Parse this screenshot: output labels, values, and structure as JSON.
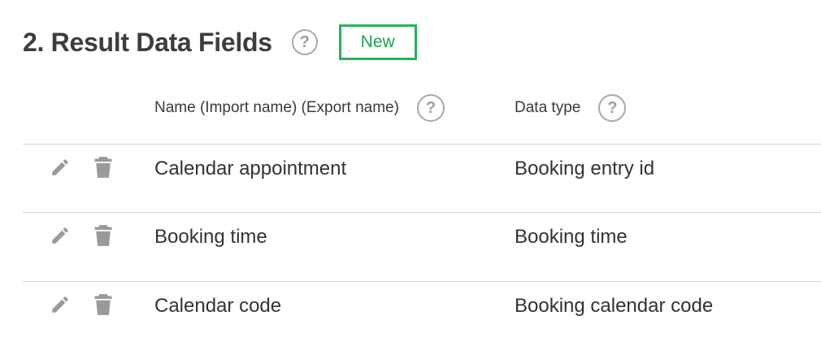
{
  "section": {
    "title": "2. Result Data Fields",
    "help_glyph": "?",
    "new_label": "New",
    "accent_color": "#25b35b"
  },
  "columns": [
    {
      "label": "Name (Import name) (Export name)",
      "help_glyph": "?"
    },
    {
      "label": "Data type",
      "help_glyph": "?"
    }
  ],
  "rows": [
    {
      "name": "Calendar appointment",
      "type": "Booking entry id",
      "edit_icon": "pencil-icon",
      "delete_icon": "trash-icon"
    },
    {
      "name": "Booking time",
      "type": "Booking time",
      "edit_icon": "pencil-icon",
      "delete_icon": "trash-icon"
    },
    {
      "name": "Calendar code",
      "type": "Booking calendar code",
      "edit_icon": "pencil-icon",
      "delete_icon": "trash-icon"
    }
  ]
}
